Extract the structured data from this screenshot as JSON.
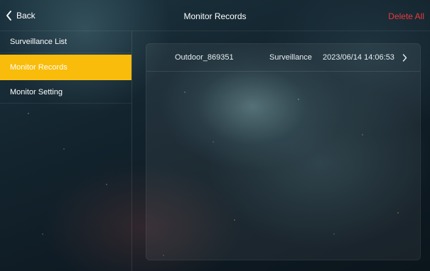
{
  "header": {
    "back_label": "Back",
    "title": "Monitor Records",
    "delete_all_label": "Delete All"
  },
  "sidebar": {
    "items": [
      {
        "label": "Surveillance List",
        "active": false
      },
      {
        "label": "Monitor Records",
        "active": true
      },
      {
        "label": "Monitor Setting",
        "active": false
      }
    ]
  },
  "records": [
    {
      "name": "Outdoor_869351",
      "type": "Surveillance",
      "time": "2023/06/14 14:06:53"
    }
  ],
  "icons": {
    "back": "chevron-left-icon",
    "row_arrow": "chevron-right-icon"
  },
  "colors": {
    "accent": "#F9BC0B",
    "danger": "#E83A3F"
  }
}
